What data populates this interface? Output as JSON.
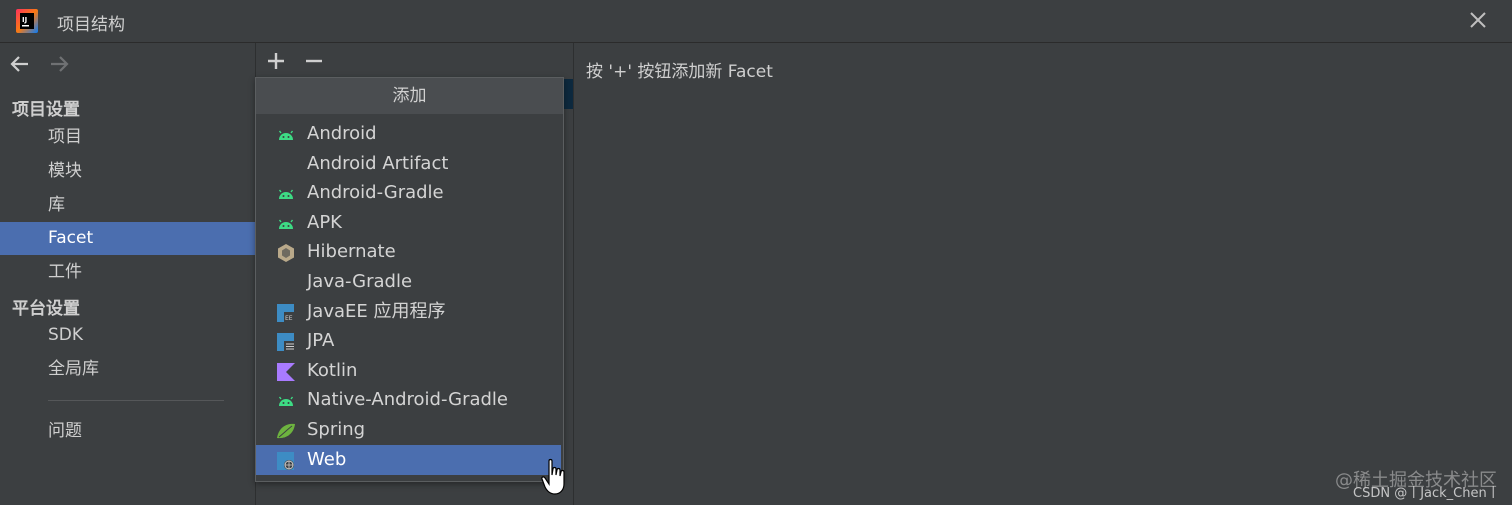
{
  "window": {
    "title": "项目结构"
  },
  "sidebar": {
    "project_settings_header": "项目设置",
    "project_items": [
      {
        "label": "项目"
      },
      {
        "label": "模块"
      },
      {
        "label": "库"
      },
      {
        "label": "Facet",
        "selected": true
      },
      {
        "label": "工件"
      }
    ],
    "platform_settings_header": "平台设置",
    "platform_items": [
      {
        "label": "SDK"
      },
      {
        "label": "全局库"
      }
    ],
    "problems_label": "问题"
  },
  "popup": {
    "header": "添加",
    "items": [
      {
        "label": "Android",
        "icon": "android-icon"
      },
      {
        "label": "Android Artifact",
        "icon": ""
      },
      {
        "label": "Android-Gradle",
        "icon": "android-icon"
      },
      {
        "label": "APK",
        "icon": "android-icon"
      },
      {
        "label": "Hibernate",
        "icon": "hibernate-icon"
      },
      {
        "label": "Java-Gradle",
        "icon": ""
      },
      {
        "label": "JavaEE 应用程序",
        "icon": "javaee-icon"
      },
      {
        "label": "JPA",
        "icon": "jpa-icon"
      },
      {
        "label": "Kotlin",
        "icon": "kotlin-icon"
      },
      {
        "label": "Native-Android-Gradle",
        "icon": "android-icon"
      },
      {
        "label": "Spring",
        "icon": "spring-leaf-icon"
      },
      {
        "label": "Web",
        "icon": "web-icon",
        "selected": true
      }
    ]
  },
  "content": {
    "hint": "按 '+' 按钮添加新 Facet"
  },
  "watermark": {
    "line1": "@稀土掘金技术社区",
    "line2": "CSDN @丨Jack_Chen丨"
  },
  "colors": {
    "background": "#3c3f41",
    "selection": "#4b6eaf",
    "android_green": "#3ddc84"
  }
}
